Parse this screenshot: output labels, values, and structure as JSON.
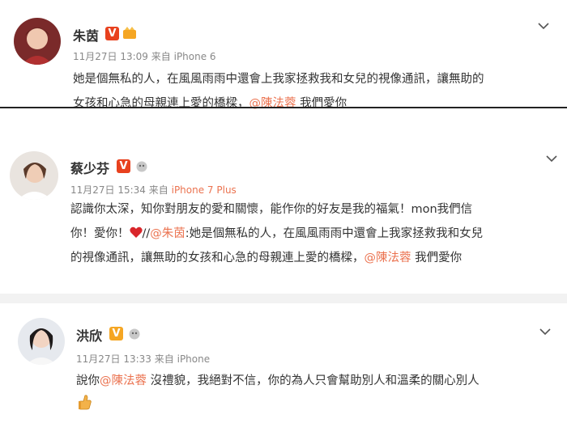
{
  "posts": [
    {
      "author": "朱茵",
      "verified_badge": "V",
      "time": "11月27日 13:09",
      "source_prefix": "来自",
      "source": "iPhone 6",
      "line1": "她是個無私的人，在風風雨雨中還會上我家拯救我和女兒的視像通訊，讓無助的",
      "line2_a": "女孩和心急的母親連上愛的橋樑，",
      "line2_mention": "@陳法蓉",
      "line2_b": " 我們愛你"
    },
    {
      "author": "蔡少芬",
      "verified_badge": "V",
      "time": "11月27日 15:34",
      "source_prefix": "来自",
      "source": "iPhone 7 Plus",
      "line1": "認識你太深，知你對朋友的愛和關懷，能作你的好友是我的福氣！mon我們信",
      "line2_a": "你！愛你！",
      "line2_sep": "//",
      "line2_mention": "@朱茵",
      "line2_b": ":她是個無私的人，在風風雨雨中還會上我家拯救我和女兒",
      "line3_a": "的視像通訊，讓無助的女孩和心急的母親連上愛的橋樑，",
      "line3_mention": "@陳法蓉",
      "line3_b": " 我們愛你"
    },
    {
      "author": "洪欣",
      "verified_badge": "V",
      "time": "11月27日 13:33",
      "source_prefix": "来自",
      "source": "iPhone",
      "line1_a": "說你",
      "line1_mention": "@陳法蓉",
      "line1_b": " 沒禮貌，我絕對不信，你的為人只會幫助別人和溫柔的關心別人",
      "emoji": "thumbs-up-icon"
    }
  ],
  "colors": {
    "mention": "#eb7350",
    "verified_red": "#e8411e",
    "verified_gold": "#f5a623",
    "meta": "#888888"
  }
}
